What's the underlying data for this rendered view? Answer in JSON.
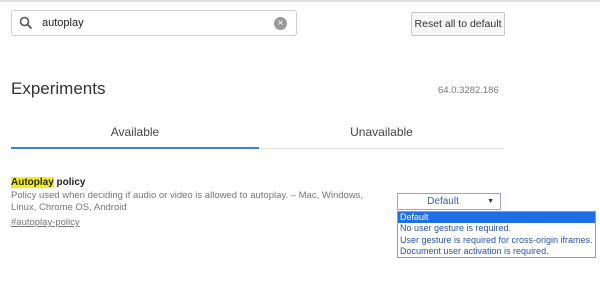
{
  "search": {
    "query": "autoplay"
  },
  "toolbar": {
    "reset_label": "Reset all to default"
  },
  "header": {
    "title": "Experiments",
    "version": "64.0.3282.186"
  },
  "tabs": [
    {
      "label": "Available"
    },
    {
      "label": "Unavailable"
    }
  ],
  "experiment": {
    "title_highlight": "Autoplay",
    "title_rest": " policy",
    "description": "Policy used when deciding if audio or video is allowed to autoplay. – Mac, Windows, Linux, Chrome OS, Android",
    "link": "#autoplay-policy",
    "selected_value": "Default",
    "options": [
      "Default",
      "No user gesture is required.",
      "User gesture is required for cross-origin iframes.",
      "Document user activation is required."
    ]
  },
  "icons": {
    "search": "search-icon",
    "clear": "clear-icon",
    "dropdown": "dropdown-arrow-icon"
  },
  "colors": {
    "accent": "#3f7ee8",
    "highlight": "#f5f10a",
    "selected_option": "#1e6ee6"
  }
}
